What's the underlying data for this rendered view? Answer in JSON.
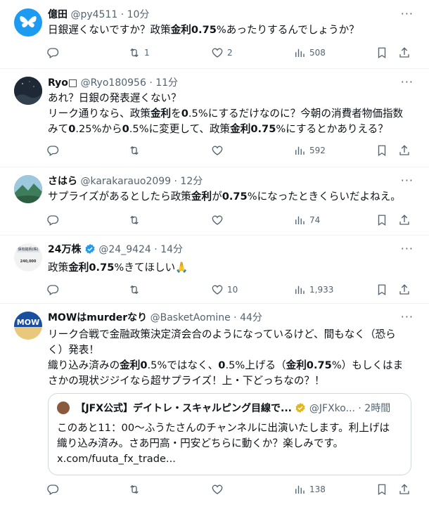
{
  "tweets": [
    {
      "name": "億田",
      "handle": "@py4511",
      "time": "· 10分",
      "lines": [
        [
          {
            "t": "日銀遅くないですか？政策"
          },
          {
            "t": "金利0.75",
            "b": true
          },
          {
            "t": "%あったりするんでしょうか？"
          }
        ]
      ],
      "stats": {
        "reply": "",
        "retweet": "1",
        "like": "2",
        "views": "508"
      },
      "avatar_color": "#1d9bf0",
      "avatar_icon": "butterfly-icon"
    },
    {
      "name": "Ryo",
      "handle": "@Ryo180956",
      "time": "· 11分",
      "lines": [
        [
          {
            "t": "あれ？日銀の発表遅くない？"
          }
        ],
        [
          {
            "t": "リーク通りなら、政策"
          },
          {
            "t": "金利",
            "b": true
          },
          {
            "t": "を"
          },
          {
            "t": "0",
            "b": true
          },
          {
            "t": ".5%にするだけなのに？今朝の消費者物価指数"
          }
        ],
        [
          {
            "t": "みて"
          },
          {
            "t": "0",
            "b": true
          },
          {
            "t": ".25%から"
          },
          {
            "t": "0",
            "b": true
          },
          {
            "t": ".5%に変更して、政策"
          },
          {
            "t": "金利0.75",
            "b": true
          },
          {
            "t": "%にするとかありえる？"
          }
        ]
      ],
      "stats": {
        "reply": "",
        "retweet": "",
        "like": "",
        "views": "592"
      },
      "avatar_color": "#1e2935",
      "avatar_icon": "night-sky-icon"
    },
    {
      "name": "さはら",
      "handle": "@karakarauo2099",
      "time": "· 12分",
      "lines": [
        [
          {
            "t": "サプライズがあるとしたら政策"
          },
          {
            "t": "金利",
            "b": true
          },
          {
            "t": "が"
          },
          {
            "t": "0.75",
            "b": true
          },
          {
            "t": "%になったときくらいだよねえ。"
          }
        ]
      ],
      "stats": {
        "reply": "",
        "retweet": "",
        "like": "",
        "views": "74"
      },
      "avatar_color": "#3e7d5a",
      "avatar_icon": "mountain-icon"
    },
    {
      "name": "24万株",
      "handle": "@24_9424",
      "time": "· 14分",
      "lines": [
        [
          {
            "t": "政策"
          },
          {
            "t": "金利0.75",
            "b": true
          },
          {
            "t": "%きてほしい🙏"
          }
        ]
      ],
      "stats": {
        "reply": "",
        "retweet": "",
        "like": "10",
        "views": "1,933"
      },
      "avatar_color": "#f2f2f2",
      "avatar_icon": "stock-card-icon",
      "avatar_text_top": "保有銘柄(株)",
      "avatar_text_bottom": "240,000"
    },
    {
      "name": "MOWはmurderなり",
      "handle": "@BasketAomine",
      "time": "· 44分",
      "lines": [
        [
          {
            "t": "リーク合戦で金融政策決定済会合のようになっているけど、間もなく（恐ら"
          }
        ],
        [
          {
            "t": "く）発表！"
          }
        ],
        [
          {
            "t": "織り込み済みの"
          },
          {
            "t": "金利0",
            "b": true
          },
          {
            "t": ".5%ではなく、"
          },
          {
            "t": "0",
            "b": true
          },
          {
            "t": ".5%上げる（"
          },
          {
            "t": "金利0.75",
            "b": true
          },
          {
            "t": "%）もしくはま"
          }
        ],
        [
          {
            "t": "さかの現状ジジイなら超サプライズ！上・下どっちなの？！"
          }
        ]
      ],
      "quote": {
        "name": "【JFX公式】デイトレ・スキャルピング目線で...",
        "handle": "@JFXko...",
        "time": "· 2時間",
        "lines": [
          "このあと11：00～ふうたさんのチャンネルに出演いたします。利上げは",
          "織り込み済み。さあ円高・円安どちらに動くか？楽しみです。",
          "x.com/fuuta_fx_trade..."
        ]
      },
      "stats": {
        "reply": "",
        "retweet": "",
        "like": "",
        "views": "138"
      },
      "avatar_color": "#1a4fa0",
      "avatar_icon": "mow-logo-icon",
      "avatar_text": "MOW"
    }
  ],
  "more_glyph": "···",
  "colors": {
    "text": "#0f1419",
    "muted": "#536471",
    "verified": "#1d9bf0",
    "border": "#eff3f4"
  }
}
